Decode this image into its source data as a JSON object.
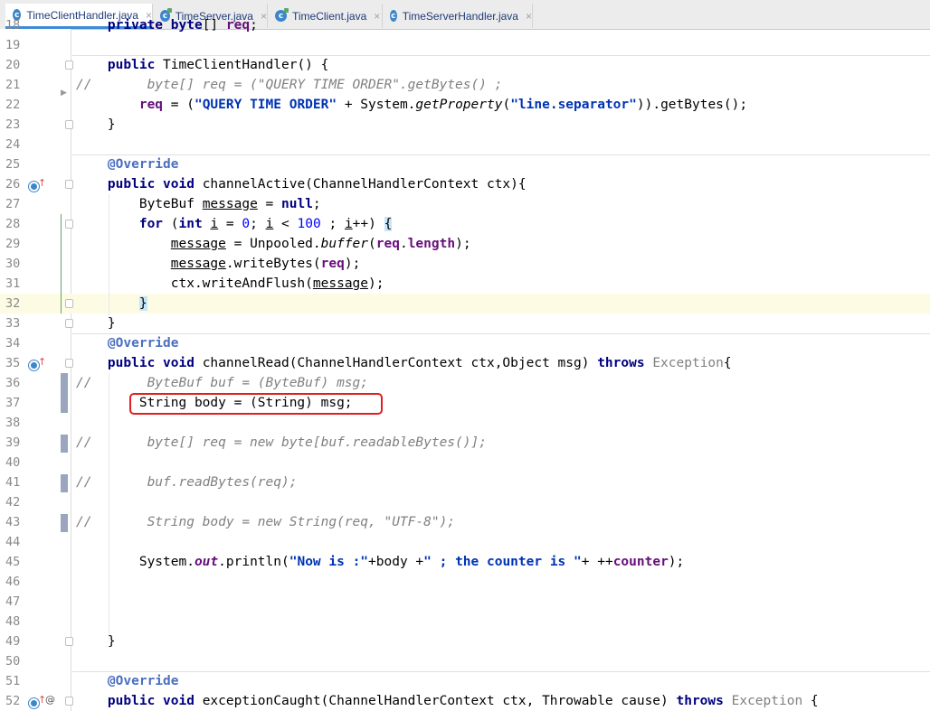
{
  "tabs": [
    {
      "label": "TimeClientHandler.java",
      "active": true,
      "icon": "class-icon"
    },
    {
      "label": "TimeServer.java",
      "active": false,
      "icon": "runnable-class-icon"
    },
    {
      "label": "TimeClient.java",
      "active": false,
      "icon": "runnable-class-icon"
    },
    {
      "label": "TimeServerHandler.java",
      "active": false,
      "icon": "class-icon"
    }
  ],
  "editor": {
    "lines": [
      {
        "n": "18",
        "text": "    private byte[] req;"
      },
      {
        "n": "19",
        "text": ""
      },
      {
        "n": "20",
        "text": "    public TimeClientHandler() {"
      },
      {
        "n": "21",
        "text": "//       byte[] req = (\"QUERY TIME ORDER\".getBytes() ;"
      },
      {
        "n": "22",
        "text": "        req = (\"QUERY TIME ORDER\" + System.getProperty(\"line.separator\")).getBytes();"
      },
      {
        "n": "23",
        "text": "    }"
      },
      {
        "n": "24",
        "text": ""
      },
      {
        "n": "25",
        "text": "    @Override"
      },
      {
        "n": "26",
        "text": "    public void channelActive(ChannelHandlerContext ctx){"
      },
      {
        "n": "27",
        "text": "        ByteBuf message = null;"
      },
      {
        "n": "28",
        "text": "        for (int i = 0; i < 100 ; i++) {"
      },
      {
        "n": "29",
        "text": "            message = Unpooled.buffer(req.length);"
      },
      {
        "n": "30",
        "text": "            message.writeBytes(req);"
      },
      {
        "n": "31",
        "text": "            ctx.writeAndFlush(message);"
      },
      {
        "n": "32",
        "text": "        }"
      },
      {
        "n": "33",
        "text": "    }"
      },
      {
        "n": "34",
        "text": "    @Override"
      },
      {
        "n": "35",
        "text": "    public void channelRead(ChannelHandlerContext ctx,Object msg) throws Exception{"
      },
      {
        "n": "36",
        "text": "//       ByteBuf buf = (ByteBuf) msg;"
      },
      {
        "n": "37",
        "text": "        String body = (String) msg;"
      },
      {
        "n": "38",
        "text": ""
      },
      {
        "n": "39",
        "text": "//       byte[] req = new byte[buf.readableBytes()];"
      },
      {
        "n": "40",
        "text": ""
      },
      {
        "n": "41",
        "text": "//       buf.readBytes(req);"
      },
      {
        "n": "42",
        "text": ""
      },
      {
        "n": "43",
        "text": "//       String body = new String(req, \"UTF-8\");"
      },
      {
        "n": "44",
        "text": ""
      },
      {
        "n": "45",
        "text": "        System.out.println(\"Now is :\"+body +\" ; the counter is \"+ ++counter);"
      },
      {
        "n": "46",
        "text": ""
      },
      {
        "n": "47",
        "text": ""
      },
      {
        "n": "48",
        "text": ""
      },
      {
        "n": "49",
        "text": "    }"
      },
      {
        "n": "50",
        "text": ""
      },
      {
        "n": "51",
        "text": "    @Override"
      },
      {
        "n": "52",
        "text": "    public void exceptionCaught(ChannelHandlerContext ctx, Throwable cause) throws Exception {"
      }
    ],
    "highlighted_line": "32",
    "boxed_line": "37"
  },
  "colors": {
    "keyword": "#000080",
    "string": "#008000",
    "comment": "#808080",
    "annotation": "#4a6fbf",
    "highlight_box": "#e02020",
    "current_line": "#fdfbe3"
  }
}
